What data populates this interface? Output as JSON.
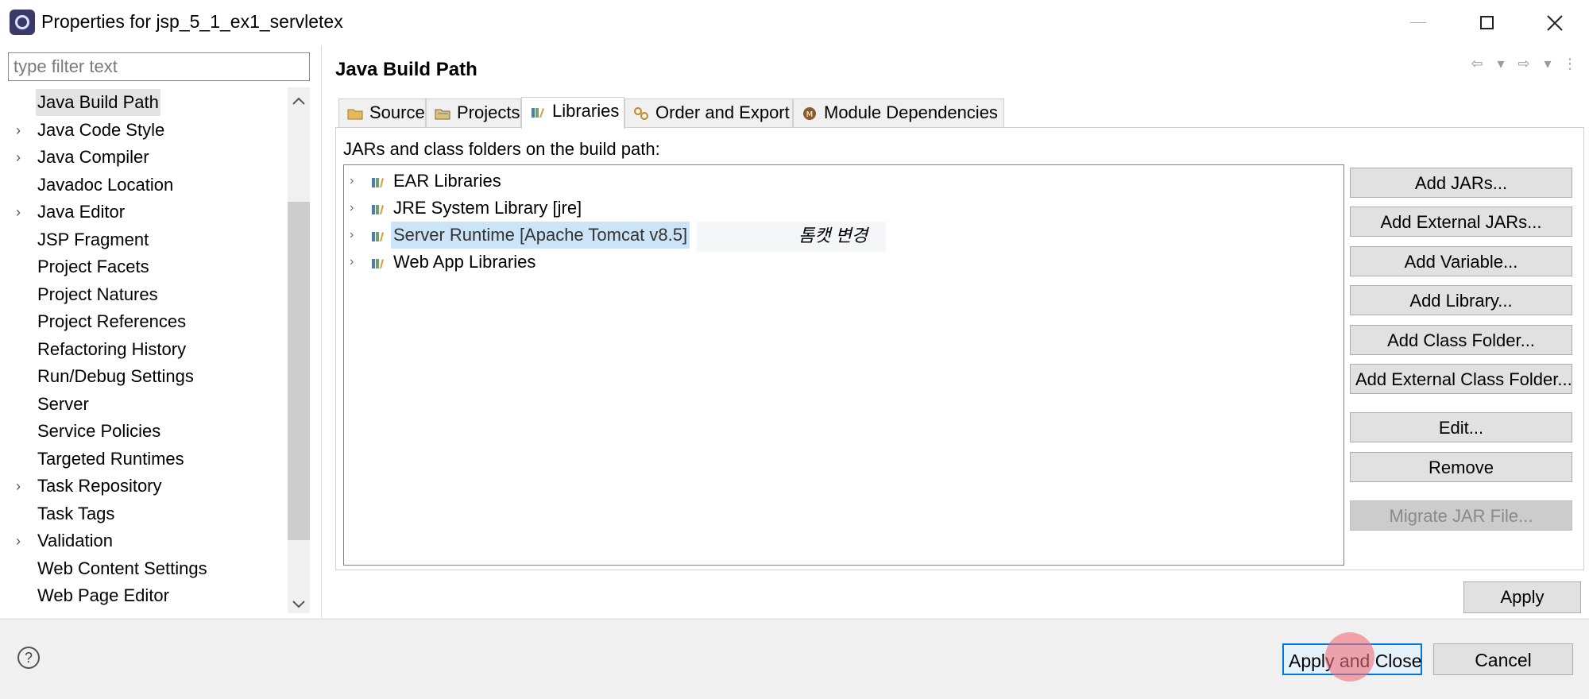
{
  "window": {
    "title": "Properties for jsp_5_1_ex1_servletex",
    "controls": [
      "minimize-icon",
      "maximize-icon",
      "close-icon"
    ]
  },
  "filter": {
    "placeholder": "type filter text",
    "value": ""
  },
  "nav": {
    "items": [
      {
        "label": "Java Build Path",
        "expandable": false,
        "selected": true
      },
      {
        "label": "Java Code Style",
        "expandable": true
      },
      {
        "label": "Java Compiler",
        "expandable": true
      },
      {
        "label": "Javadoc Location",
        "expandable": false
      },
      {
        "label": "Java Editor",
        "expandable": true
      },
      {
        "label": "JSP Fragment",
        "expandable": false
      },
      {
        "label": "Project Facets",
        "expandable": false
      },
      {
        "label": "Project Natures",
        "expandable": false
      },
      {
        "label": "Project References",
        "expandable": false
      },
      {
        "label": "Refactoring History",
        "expandable": false
      },
      {
        "label": "Run/Debug Settings",
        "expandable": false
      },
      {
        "label": "Server",
        "expandable": false
      },
      {
        "label": "Service Policies",
        "expandable": false
      },
      {
        "label": "Targeted Runtimes",
        "expandable": false
      },
      {
        "label": "Task Repository",
        "expandable": true
      },
      {
        "label": "Task Tags",
        "expandable": false
      },
      {
        "label": "Validation",
        "expandable": true
      },
      {
        "label": "Web Content Settings",
        "expandable": false
      },
      {
        "label": "Web Page Editor",
        "expandable": false
      }
    ]
  },
  "page": {
    "title": "Java Build Path",
    "tabs": [
      {
        "label": "Source",
        "icon": "source-folder-icon"
      },
      {
        "label": "Projects",
        "icon": "projects-icon"
      },
      {
        "label": "Libraries",
        "icon": "libraries-icon",
        "active": true
      },
      {
        "label": "Order and Export",
        "icon": "order-export-icon"
      },
      {
        "label": "Module Dependencies",
        "icon": "module-icon"
      }
    ],
    "heading": "JARs and class folders on the build path:",
    "libraries": [
      {
        "label": "EAR Libraries"
      },
      {
        "label": "JRE System Library [jre]"
      },
      {
        "label": "Server Runtime [Apache Tomcat v8.5]",
        "selected": true
      },
      {
        "label": "Web App Libraries"
      }
    ],
    "annotation": "톰캣 변경",
    "buttons": {
      "add_jars": "Add JARs...",
      "add_external_jars": "Add External JARs...",
      "add_variable": "Add Variable...",
      "add_library": "Add Library...",
      "add_class_folder": "Add Class Folder...",
      "add_external_class_folder": "Add External Class Folder...",
      "edit": "Edit...",
      "remove": "Remove",
      "migrate_jar": "Migrate JAR File..."
    },
    "apply": "Apply"
  },
  "footer": {
    "help": "?",
    "apply_and_close": "Apply and Close",
    "cancel": "Cancel"
  },
  "colors": {
    "selection": "#cce4f7",
    "default_button_border": "#0078d7",
    "click_marker": "#f06e78"
  }
}
